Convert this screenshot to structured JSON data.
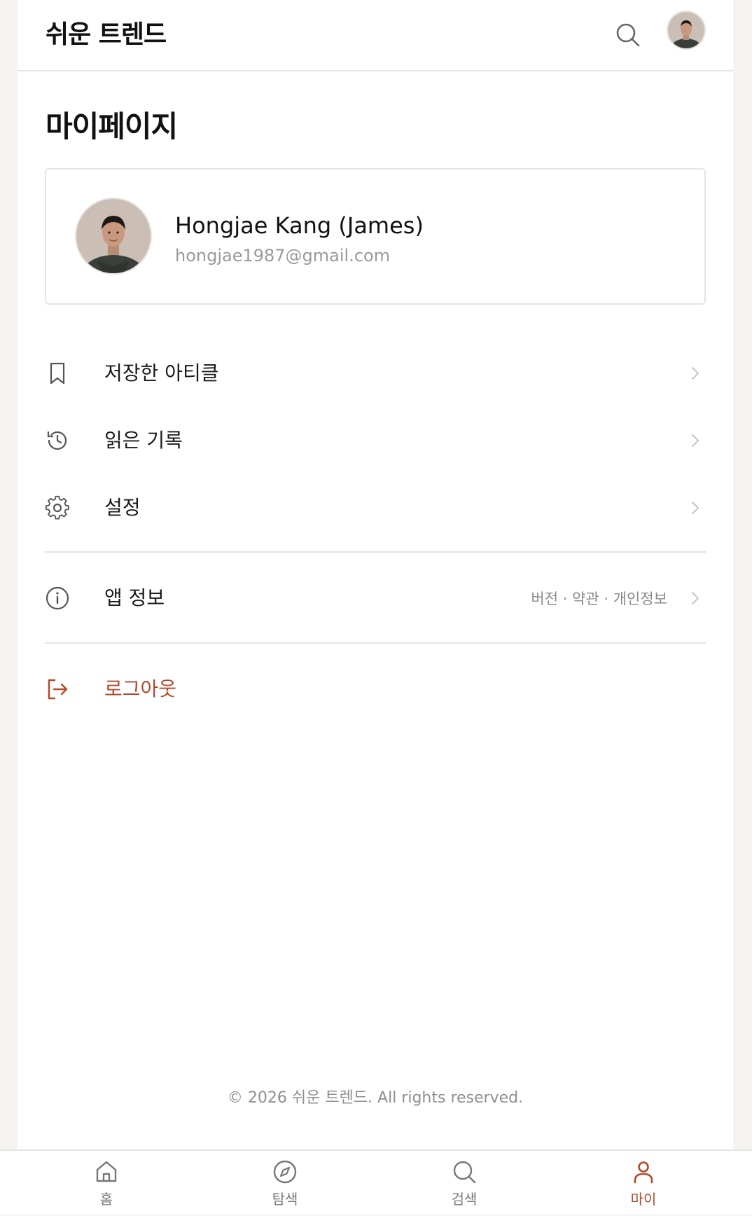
{
  "header": {
    "brand": "쉬운 트렌드",
    "search_icon": "search-icon",
    "avatar_icon": "user-avatar"
  },
  "page": {
    "title": "마이페이지"
  },
  "profile": {
    "name": "Hongjae Kang (James)",
    "email": "hongjae1987@gmail.com"
  },
  "menu": {
    "items": [
      {
        "label": "저장한 아티클",
        "icon": "bookmark-icon"
      },
      {
        "label": "읽은 기록",
        "icon": "history-icon"
      },
      {
        "label": "설정",
        "icon": "gear-icon"
      }
    ],
    "app_info": {
      "label": "앱 정보",
      "hint": "버전 · 약관 · 개인정보",
      "icon": "info-icon"
    },
    "logout": {
      "label": "로그아웃",
      "icon": "logout-icon",
      "color": "#b14a2c"
    }
  },
  "footer": {
    "copyright": "© 2026 쉬운 트렌드. All rights reserved."
  },
  "bottom_nav": {
    "items": [
      {
        "label": "홈",
        "icon": "home-icon",
        "active": false
      },
      {
        "label": "탐색",
        "icon": "compass-icon",
        "active": false
      },
      {
        "label": "검색",
        "icon": "search-icon",
        "active": false
      },
      {
        "label": "마이",
        "icon": "user-icon",
        "active": true
      }
    ],
    "active_color": "#b14a2c"
  }
}
